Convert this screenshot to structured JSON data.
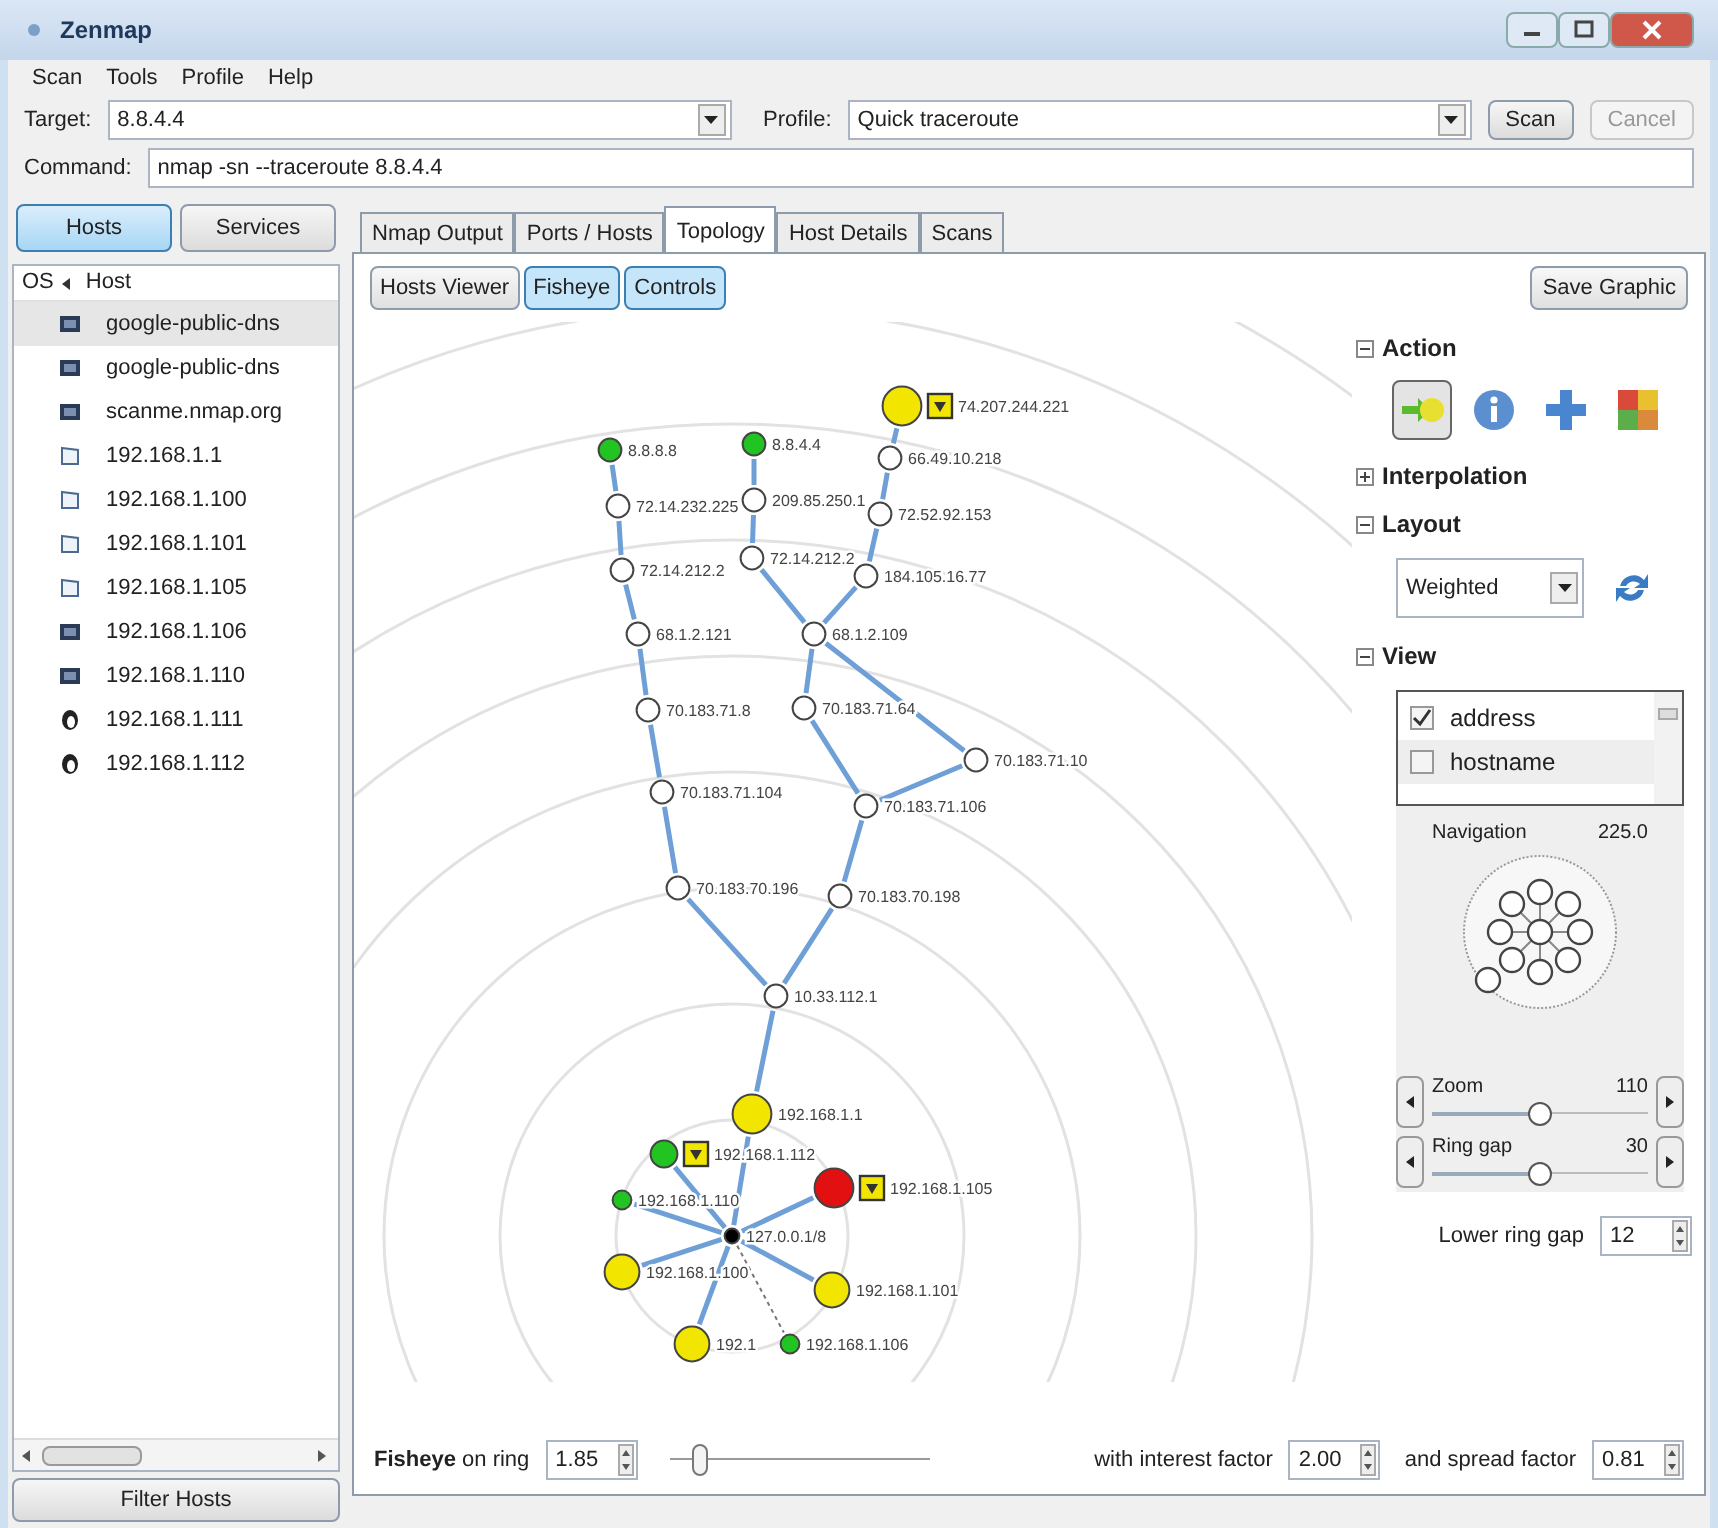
{
  "window": {
    "title": "Zenmap"
  },
  "menu": [
    "Scan",
    "Tools",
    "Profile",
    "Help"
  ],
  "target": {
    "label": "Target:",
    "value": "8.8.4.4"
  },
  "profile": {
    "label": "Profile:",
    "value": "Quick traceroute"
  },
  "buttons": [
    {
      "label": "Scan",
      "disabled": false
    },
    {
      "label": "Cancel",
      "disabled": true
    }
  ],
  "command": {
    "label": "Command:",
    "value": "nmap -sn --traceroute 8.8.4.4"
  },
  "view_toggle": [
    {
      "label": "Hosts",
      "selected": true
    },
    {
      "label": "Services",
      "selected": false
    }
  ],
  "host_list": {
    "columns": [
      "OS",
      "Host"
    ],
    "rows": [
      {
        "kind": "dark",
        "host": "google-public-dns",
        "selected": true
      },
      {
        "kind": "dark",
        "host": "google-public-dns",
        "selected": false
      },
      {
        "kind": "dark",
        "host": "scanme.nmap.org",
        "selected": false
      },
      {
        "kind": "outline",
        "host": "192.168.1.1",
        "selected": false
      },
      {
        "kind": "outline",
        "host": "192.168.1.100",
        "selected": false
      },
      {
        "kind": "outline",
        "host": "192.168.1.101",
        "selected": false
      },
      {
        "kind": "outline",
        "host": "192.168.1.105",
        "selected": false
      },
      {
        "kind": "dark",
        "host": "192.168.1.106",
        "selected": false
      },
      {
        "kind": "dark",
        "host": "192.168.1.110",
        "selected": false
      },
      {
        "kind": "penguin",
        "host": "192.168.1.111",
        "selected": false
      },
      {
        "kind": "penguin",
        "host": "192.168.1.112",
        "selected": false
      }
    ]
  },
  "filter_button": "Filter Hosts",
  "tabs": [
    {
      "label": "Nmap Output",
      "selected": false
    },
    {
      "label": "Ports / Hosts",
      "selected": false
    },
    {
      "label": "Topology",
      "selected": true
    },
    {
      "label": "Host Details",
      "selected": false
    },
    {
      "label": "Scans",
      "selected": false
    }
  ],
  "topology": {
    "view_buttons": [
      {
        "label": "Hosts Viewer",
        "selected": false
      },
      {
        "label": "Fisheye",
        "selected": true
      },
      {
        "label": "Controls",
        "selected": true
      }
    ],
    "save_button": "Save Graphic",
    "nodes": [
      {
        "label": "74.207.244.221",
        "color": "#f2e600",
        "marked": true
      },
      {
        "label": "8.8.8.8",
        "color": "#22c422",
        "marked": false
      },
      {
        "label": "8.8.4.4",
        "color": "#22c422",
        "marked": false
      },
      {
        "label": "66.49.10.218",
        "color": "#ffffff",
        "marked": false
      },
      {
        "label": "72.14.232.225",
        "color": "#ffffff",
        "marked": false
      },
      {
        "label": "209.85.250.1",
        "color": "#ffffff",
        "marked": false
      },
      {
        "label": "72.52.92.153",
        "color": "#ffffff",
        "marked": false
      },
      {
        "label": "72.14.212.2",
        "color": "#ffffff",
        "marked": false
      },
      {
        "label": "72.14.212.2",
        "color": "#ffffff",
        "marked": false
      },
      {
        "label": "184.105.16.77",
        "color": "#ffffff",
        "marked": false
      },
      {
        "label": "68.1.2.121",
        "color": "#ffffff",
        "marked": false
      },
      {
        "label": "68.1.2.109",
        "color": "#ffffff",
        "marked": false
      },
      {
        "label": "70.183.71.8",
        "color": "#ffffff",
        "marked": false
      },
      {
        "label": "70.183.71.64",
        "color": "#ffffff",
        "marked": false
      },
      {
        "label": "70.183.71.10",
        "color": "#ffffff",
        "marked": false
      },
      {
        "label": "70.183.71.104",
        "color": "#ffffff",
        "marked": false
      },
      {
        "label": "70.183.71.106",
        "color": "#ffffff",
        "marked": false
      },
      {
        "label": "70.183.70.196",
        "color": "#ffffff",
        "marked": false
      },
      {
        "label": "70.183.70.198",
        "color": "#ffffff",
        "marked": false
      },
      {
        "label": "10.33.112.1",
        "color": "#ffffff",
        "marked": false
      },
      {
        "label": "192.168.1.1",
        "color": "#f2e600",
        "marked": false
      },
      {
        "label": "192.168.1.112",
        "color": "#22c422",
        "marked": true
      },
      {
        "label": "192.168.1.110",
        "color": "#22c422",
        "marked": false
      },
      {
        "label": "192.168.1.105",
        "color": "#e21010",
        "marked": true
      },
      {
        "label": "127.0.0.1/8",
        "color": "#000000",
        "marked": false
      },
      {
        "label": "192.168.1.100",
        "color": "#f2e600",
        "marked": false
      },
      {
        "label": "192.168.1.101",
        "color": "#f2e600",
        "marked": false
      },
      {
        "label": "192.1",
        "color": "#f2e600",
        "marked": false
      },
      {
        "label": "192.168.1.106",
        "color": "#22c422",
        "marked": false
      }
    ],
    "controls": {
      "action": {
        "title": "Action",
        "expanded": true,
        "tools": [
          {
            "selected": true
          },
          {
            "selected": false
          },
          {
            "selected": false
          },
          {
            "selected": false
          }
        ]
      },
      "interpolation": {
        "title": "Interpolation",
        "expanded": false
      },
      "layout": {
        "title": "Layout",
        "expanded": true,
        "value": "Weighted"
      },
      "view": {
        "title": "View",
        "expanded": true,
        "options": [
          {
            "label": "address",
            "checked": true
          },
          {
            "label": "hostname",
            "checked": false
          }
        ],
        "navigation": {
          "label": "Navigation",
          "value": "225.0"
        },
        "zoom": {
          "label": "Zoom",
          "value": "110",
          "level": 0.5
        },
        "ring_gap": {
          "label": "Ring gap",
          "value": "30",
          "level": 0.5
        },
        "lower_ring_gap": {
          "label": "Lower ring gap",
          "value": "12"
        }
      }
    },
    "fisheye": {
      "label": "**Fisheye** on ring",
      "ring": "1.85",
      "level": 0.12,
      "interest_label": "with interest factor",
      "interest": "2.00",
      "spread_label": "and spread factor",
      "spread": "0.81"
    }
  }
}
